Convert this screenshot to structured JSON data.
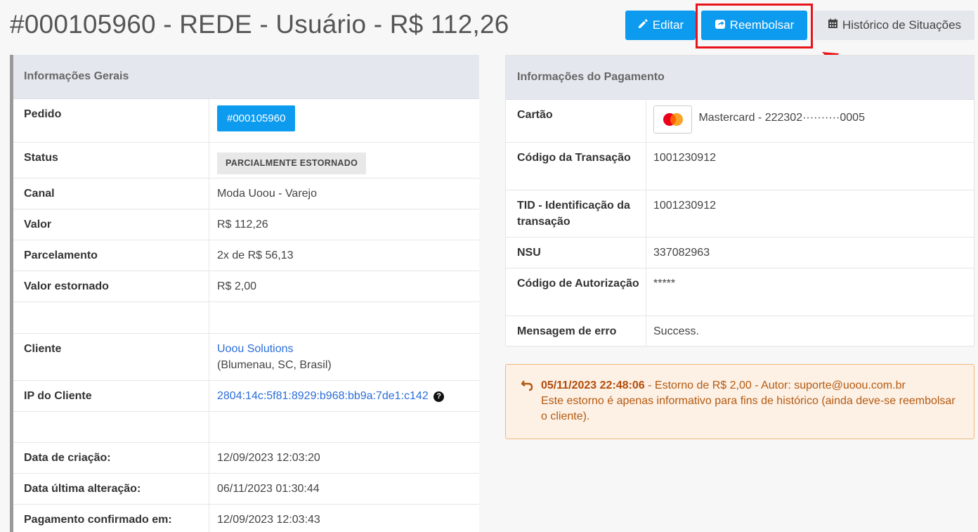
{
  "header": {
    "title": "#000105960 - REDE - Usuário - R$ 112,26",
    "edit_label": "Editar",
    "refund_label": "Reembolsar",
    "history_label": "Histórico de Situações"
  },
  "general": {
    "title": "Informações Gerais",
    "pedido_label": "Pedido",
    "pedido_value": "#000105960",
    "status_label": "Status",
    "status_value": "PARCIALMENTE ESTORNADO",
    "canal_label": "Canal",
    "canal_value": "Moda Uoou - Varejo",
    "valor_label": "Valor",
    "valor_value": "R$ 112,26",
    "parcelamento_label": "Parcelamento",
    "parcelamento_value": "2x de R$ 56,13",
    "estornado_label": "Valor estornado",
    "estornado_value": "R$ 2,00",
    "cliente_label": "Cliente",
    "cliente_name": "Uoou Solutions",
    "cliente_location": "(Blumenau, SC, Brasil)",
    "ip_label": "IP do Cliente",
    "ip_value": "2804:14c:5f81:8929:b968:bb9a:7de1:c142",
    "criacao_label": "Data de criação:",
    "criacao_value": "12/09/2023 12:03:20",
    "alteracao_label": "Data última alteração:",
    "alteracao_value": "06/11/2023 01:30:44",
    "confirmado_label": "Pagamento confirmado em:",
    "confirmado_value": "12/09/2023 12:03:43"
  },
  "payment": {
    "title": "Informações do Pagamento",
    "cartao_label": "Cartão",
    "cartao_value": "Mastercard - 222302··········0005",
    "codigo_label": "Código da Transação",
    "codigo_value": "1001230912",
    "tid_label": "TID - Identificação da transação",
    "tid_value": "1001230912",
    "nsu_label": "NSU",
    "nsu_value": "337082963",
    "autorizacao_label": "Código de Autorização",
    "autorizacao_value": "*****",
    "erro_label": "Mensagem de erro",
    "erro_value": "Success."
  },
  "refund_alert": {
    "timestamp": "05/11/2023 22:48:06",
    "text": " - Estorno de R$ 2,00 - Autor: suporte@uoou.com.br",
    "note": "Este estorno é apenas informativo para fins de histórico (ainda deve-se reembolsar o cliente)."
  },
  "colors": {
    "primary": "#0d9bf0",
    "highlight": "#e8141b",
    "alert_bg": "#fdf0e4",
    "alert_text": "#b35b12"
  },
  "icons": [
    "pencil-icon",
    "external-link-icon",
    "calendar-icon",
    "question-icon",
    "mastercard-icon",
    "undo-icon",
    "red-arrow"
  ]
}
